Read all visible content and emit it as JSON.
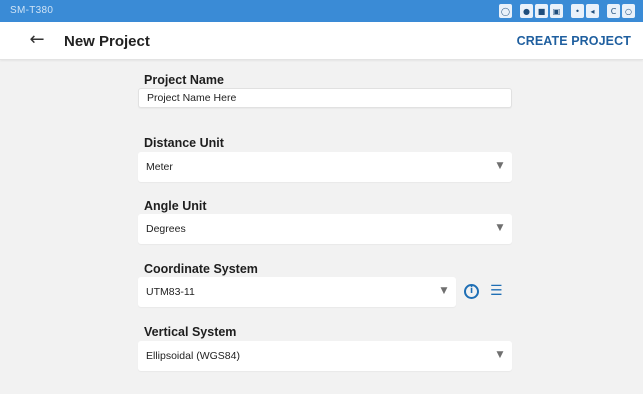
{
  "status_bar": {
    "device_name": "SM-T380",
    "icons": [
      "headset-icon",
      "record-icon",
      "video-icon",
      "image-icon",
      "signal-icon",
      "volume-icon",
      "phone-icon",
      "globe-icon"
    ],
    "color": "#3a8bd6"
  },
  "app_bar": {
    "back_icon": "arrow-left-icon",
    "title": "New Project",
    "action_label": "CREATE PROJECT",
    "action_color": "#1f5f9f"
  },
  "form": {
    "project_name": {
      "label": "Project Name",
      "value": "Project Name Here"
    },
    "distance_unit": {
      "label": "Distance Unit",
      "value": "Meter"
    },
    "angle_unit": {
      "label": "Angle Unit",
      "value": "Degrees"
    },
    "coordinate_system": {
      "label": "Coordinate System",
      "value": "UTM83-11",
      "info_icon": "info-icon",
      "list_icon": "list-icon"
    },
    "vertical_system": {
      "label": "Vertical System",
      "value": "Ellipsoidal (WGS84)"
    }
  }
}
